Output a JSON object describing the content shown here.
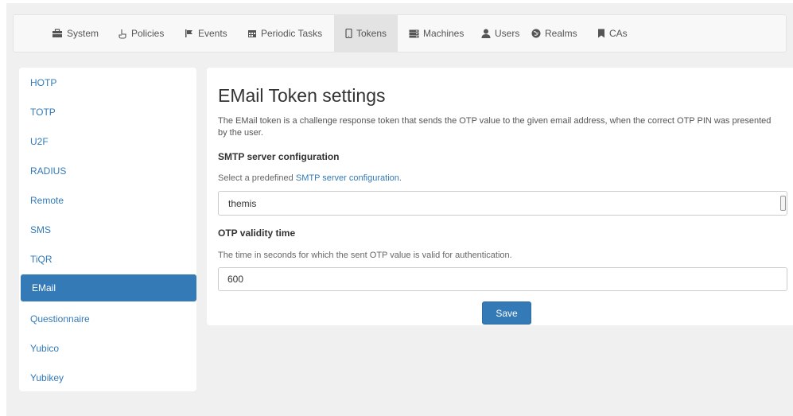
{
  "navbar": {
    "items": [
      {
        "label": "System",
        "icon": "briefcase-icon"
      },
      {
        "label": "Policies",
        "icon": "hand-icon"
      },
      {
        "label": "Events",
        "icon": "flag-icon"
      },
      {
        "label": "Periodic Tasks",
        "icon": "calendar-icon"
      },
      {
        "label": "Tokens",
        "icon": "phone-icon",
        "active": true
      },
      {
        "label": "Machines",
        "icon": "server-icon"
      },
      {
        "label": "Users",
        "icon": "user-icon"
      },
      {
        "label": "Realms",
        "icon": "globe-icon"
      },
      {
        "label": "CAs",
        "icon": "bookmark-icon"
      }
    ]
  },
  "sidebar": {
    "items": [
      {
        "label": "HOTP"
      },
      {
        "label": "TOTP"
      },
      {
        "label": "U2F"
      },
      {
        "label": "RADIUS"
      },
      {
        "label": "Remote"
      },
      {
        "label": "SMS"
      },
      {
        "label": "TiQR"
      },
      {
        "label": "EMail",
        "active": true
      },
      {
        "label": "Questionnaire"
      },
      {
        "label": "Yubico"
      },
      {
        "label": "Yubikey"
      }
    ]
  },
  "main": {
    "title": "EMail Token settings",
    "description": "The EMail token is a challenge response token that sends the OTP value to the given email address, when the correct OTP PIN was presented by the user.",
    "smtp_heading": "SMTP server configuration",
    "smtp_help_prefix": "Select a predefined ",
    "smtp_help_link": "SMTP server configuration",
    "smtp_help_suffix": ".",
    "smtp_selected": "themis",
    "validity_heading": "OTP validity time",
    "validity_help": "The time in seconds for which the sent OTP value is valid for authentication.",
    "validity_value": "600",
    "save_label": "Save"
  },
  "colors": {
    "accent": "#337ab7",
    "background": "#f0f0f0"
  }
}
